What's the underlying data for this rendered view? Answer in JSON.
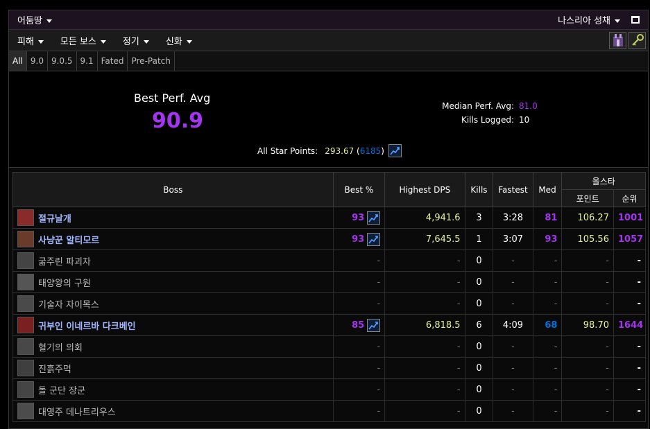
{
  "topbar": {
    "zone": "어둠땅",
    "raid": "나스리아 성채"
  },
  "menubar": {
    "items": [
      "피해",
      "모든 보스",
      "정기",
      "신화"
    ]
  },
  "tabs": [
    "All",
    "9.0",
    "9.0.5",
    "9.1",
    "Fated",
    "Pre-Patch"
  ],
  "summary": {
    "best_perf_label": "Best Perf. Avg",
    "best_perf_value": "90.9",
    "median_label": "Median Perf. Avg:",
    "median_value": "81.0",
    "kills_label": "Kills Logged:",
    "kills_value": "10",
    "asp_label": "All Star Points:",
    "asp_points": "293.67",
    "asp_open": "(",
    "asp_rank": "6185",
    "asp_close": ")"
  },
  "table": {
    "headers": {
      "boss": "Boss",
      "best": "Best %",
      "dps": "Highest DPS",
      "kills": "Kills",
      "fastest": "Fastest",
      "med": "Med",
      "allstar": "올스타",
      "points": "포인트",
      "rank": "순위"
    },
    "rows": [
      {
        "name": "절규날개",
        "best": "93",
        "dps": "4,941.6",
        "kills": "3",
        "fastest": "3:28",
        "med": "81",
        "points": "106.27",
        "rank": "1001",
        "lit": true,
        "icon": "#8a2a2a",
        "med_color": "#a335ee"
      },
      {
        "name": "사냥꾼 알티모르",
        "best": "93",
        "dps": "7,645.5",
        "kills": "1",
        "fastest": "3:07",
        "med": "93",
        "points": "105.56",
        "rank": "1057",
        "lit": true,
        "icon": "#6a3a2a",
        "med_color": "#a335ee"
      },
      {
        "name": "굶주린 파괴자",
        "best": "-",
        "dps": "-",
        "kills": "0",
        "fastest": "-",
        "med": "-",
        "points": "-",
        "rank": "-",
        "lit": false,
        "icon": "#444"
      },
      {
        "name": "태양왕의 구원",
        "best": "-",
        "dps": "-",
        "kills": "0",
        "fastest": "-",
        "med": "-",
        "points": "-",
        "rank": "-",
        "lit": false,
        "icon": "#555"
      },
      {
        "name": "기술자 자이목스",
        "best": "-",
        "dps": "-",
        "kills": "0",
        "fastest": "-",
        "med": "-",
        "points": "-",
        "rank": "-",
        "lit": false,
        "icon": "#4a4a4a"
      },
      {
        "name": "귀부인 이네르바 다크베인",
        "best": "85",
        "dps": "6,818.5",
        "kills": "6",
        "fastest": "4:09",
        "med": "68",
        "points": "98.70",
        "rank": "1644",
        "lit": true,
        "icon": "#7a2020",
        "med_color": "#0070dd"
      },
      {
        "name": "혈기의 의회",
        "best": "-",
        "dps": "-",
        "kills": "0",
        "fastest": "-",
        "med": "-",
        "points": "-",
        "rank": "-",
        "lit": false,
        "icon": "#484848"
      },
      {
        "name": "진흙주먹",
        "best": "-",
        "dps": "-",
        "kills": "0",
        "fastest": "-",
        "med": "-",
        "points": "-",
        "rank": "-",
        "lit": false,
        "icon": "#3f3f3f"
      },
      {
        "name": "돌 군단 장군",
        "best": "-",
        "dps": "-",
        "kills": "0",
        "fastest": "-",
        "med": "-",
        "points": "-",
        "rank": "-",
        "lit": false,
        "icon": "#454545"
      },
      {
        "name": "대영주 데나트리우스",
        "best": "-",
        "dps": "-",
        "kills": "0",
        "fastest": "-",
        "med": "-",
        "points": "-",
        "rank": "-",
        "lit": false,
        "icon": "#4c4c4c"
      }
    ]
  },
  "colors": {
    "purple": "#a335ee",
    "blue": "#0070dd",
    "green": "#e2f39e",
    "boss_link": "#a0b5ff"
  },
  "icons": {
    "asp_icon": "chart-trend-icon",
    "menu_icons": [
      "raid-portal-icon",
      "key-icon"
    ]
  }
}
